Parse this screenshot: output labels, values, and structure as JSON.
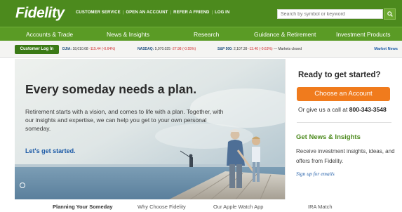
{
  "header": {
    "logo": "Fidelity",
    "links": [
      "CUSTOMER SERVICE",
      "OPEN AN ACCOUNT",
      "REFER A FRIEND",
      "LOG IN"
    ],
    "search_placeholder": "Search by symbol or keyword",
    "search_button_icon": "search-icon"
  },
  "nav": [
    "Accounts & Trade",
    "News & Insights",
    "Research",
    "Guidance & Retirement",
    "Investment Products"
  ],
  "ticker": {
    "login_label": "Customer Log In",
    "djia_label": "DJIA:",
    "djia_value": "18,010.68",
    "djia_change": "-115.44 (-0.64%)",
    "nasdaq_label": "NASDAQ:",
    "nasdaq_value": "5,070.025",
    "nasdaq_change": "-27.98 (-0.55%)",
    "sp_label": "S&P 500:",
    "sp_value": "2,107.39",
    "sp_change": "-13.40 (-0.63%)",
    "status": "— Markets closed",
    "market_news": "Market News"
  },
  "hero": {
    "headline": "Every someday needs a plan.",
    "body": "Retirement starts with a vision, and comes to life with a plan. Together, with our insights and expertise, we can help you get to your own personal someday.",
    "cta": "Let's get started."
  },
  "panel": {
    "title": "Ready to get started?",
    "button": "Choose an Account",
    "call_text": "Or give us a call at",
    "phone": "800-343-3548",
    "news_title": "Get News & Insights",
    "news_body": "Receive investment insights, ideas, and offers from Fidelity.",
    "signup": "Sign up for emails"
  },
  "tabs": [
    "Planning Your Someday",
    "Why Choose Fidelity",
    "Our Apple Watch App",
    "IRA Match"
  ],
  "colors": {
    "brand_green": "#4c8a1d",
    "nav_green": "#5a9b25",
    "accent_orange": "#f07b1d",
    "link_blue": "#1c5aa6",
    "negative_red": "#d0282a"
  }
}
